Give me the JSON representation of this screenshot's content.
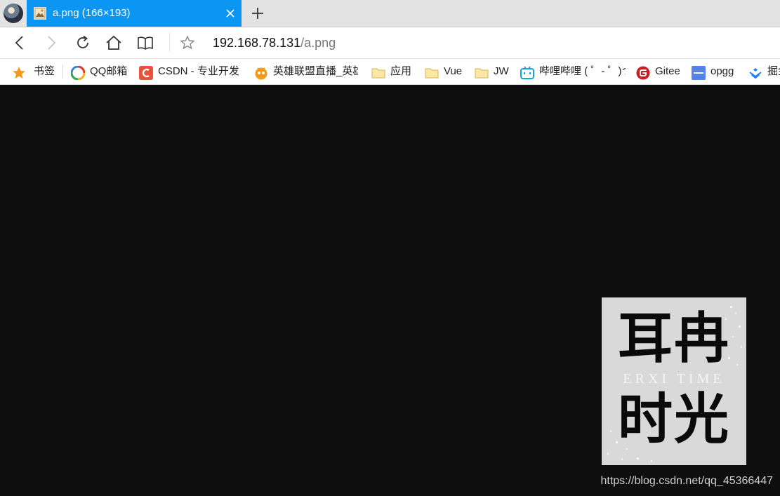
{
  "tab": {
    "title": "a.png (166×193)"
  },
  "address": {
    "host": "192.168.78.131",
    "path": "/a.png"
  },
  "bookmarks": [
    {
      "label": "书签",
      "icon": "star-icon"
    },
    {
      "label": "QQ邮箱",
      "icon": "qq-mail-icon"
    },
    {
      "label": "CSDN - 专业开发",
      "icon": "csdn-icon"
    },
    {
      "label": "英雄联盟直播_英雄",
      "icon": "live-stream-icon"
    },
    {
      "label": "应用",
      "icon": "folder-icon"
    },
    {
      "label": "Vue",
      "icon": "folder-icon"
    },
    {
      "label": "JW",
      "icon": "folder-icon"
    },
    {
      "label": "哔哩哔哩 ( ゜- ゜)つ",
      "icon": "bilibili-icon"
    },
    {
      "label": "Gitee",
      "icon": "gitee-icon"
    },
    {
      "label": "opgg",
      "icon": "opgg-icon"
    },
    {
      "label": "掘金",
      "icon": "juejin-icon"
    }
  ],
  "image": {
    "top_text": "耳冉",
    "mid_text": "ERXI TIME",
    "bottom_text": "时光"
  },
  "watermark": "https://blog.csdn.net/qq_45366447",
  "colors": {
    "tab_active": "#0a96f2",
    "page_background": "#0e0e0e",
    "image_background": "#d9d9d9"
  }
}
